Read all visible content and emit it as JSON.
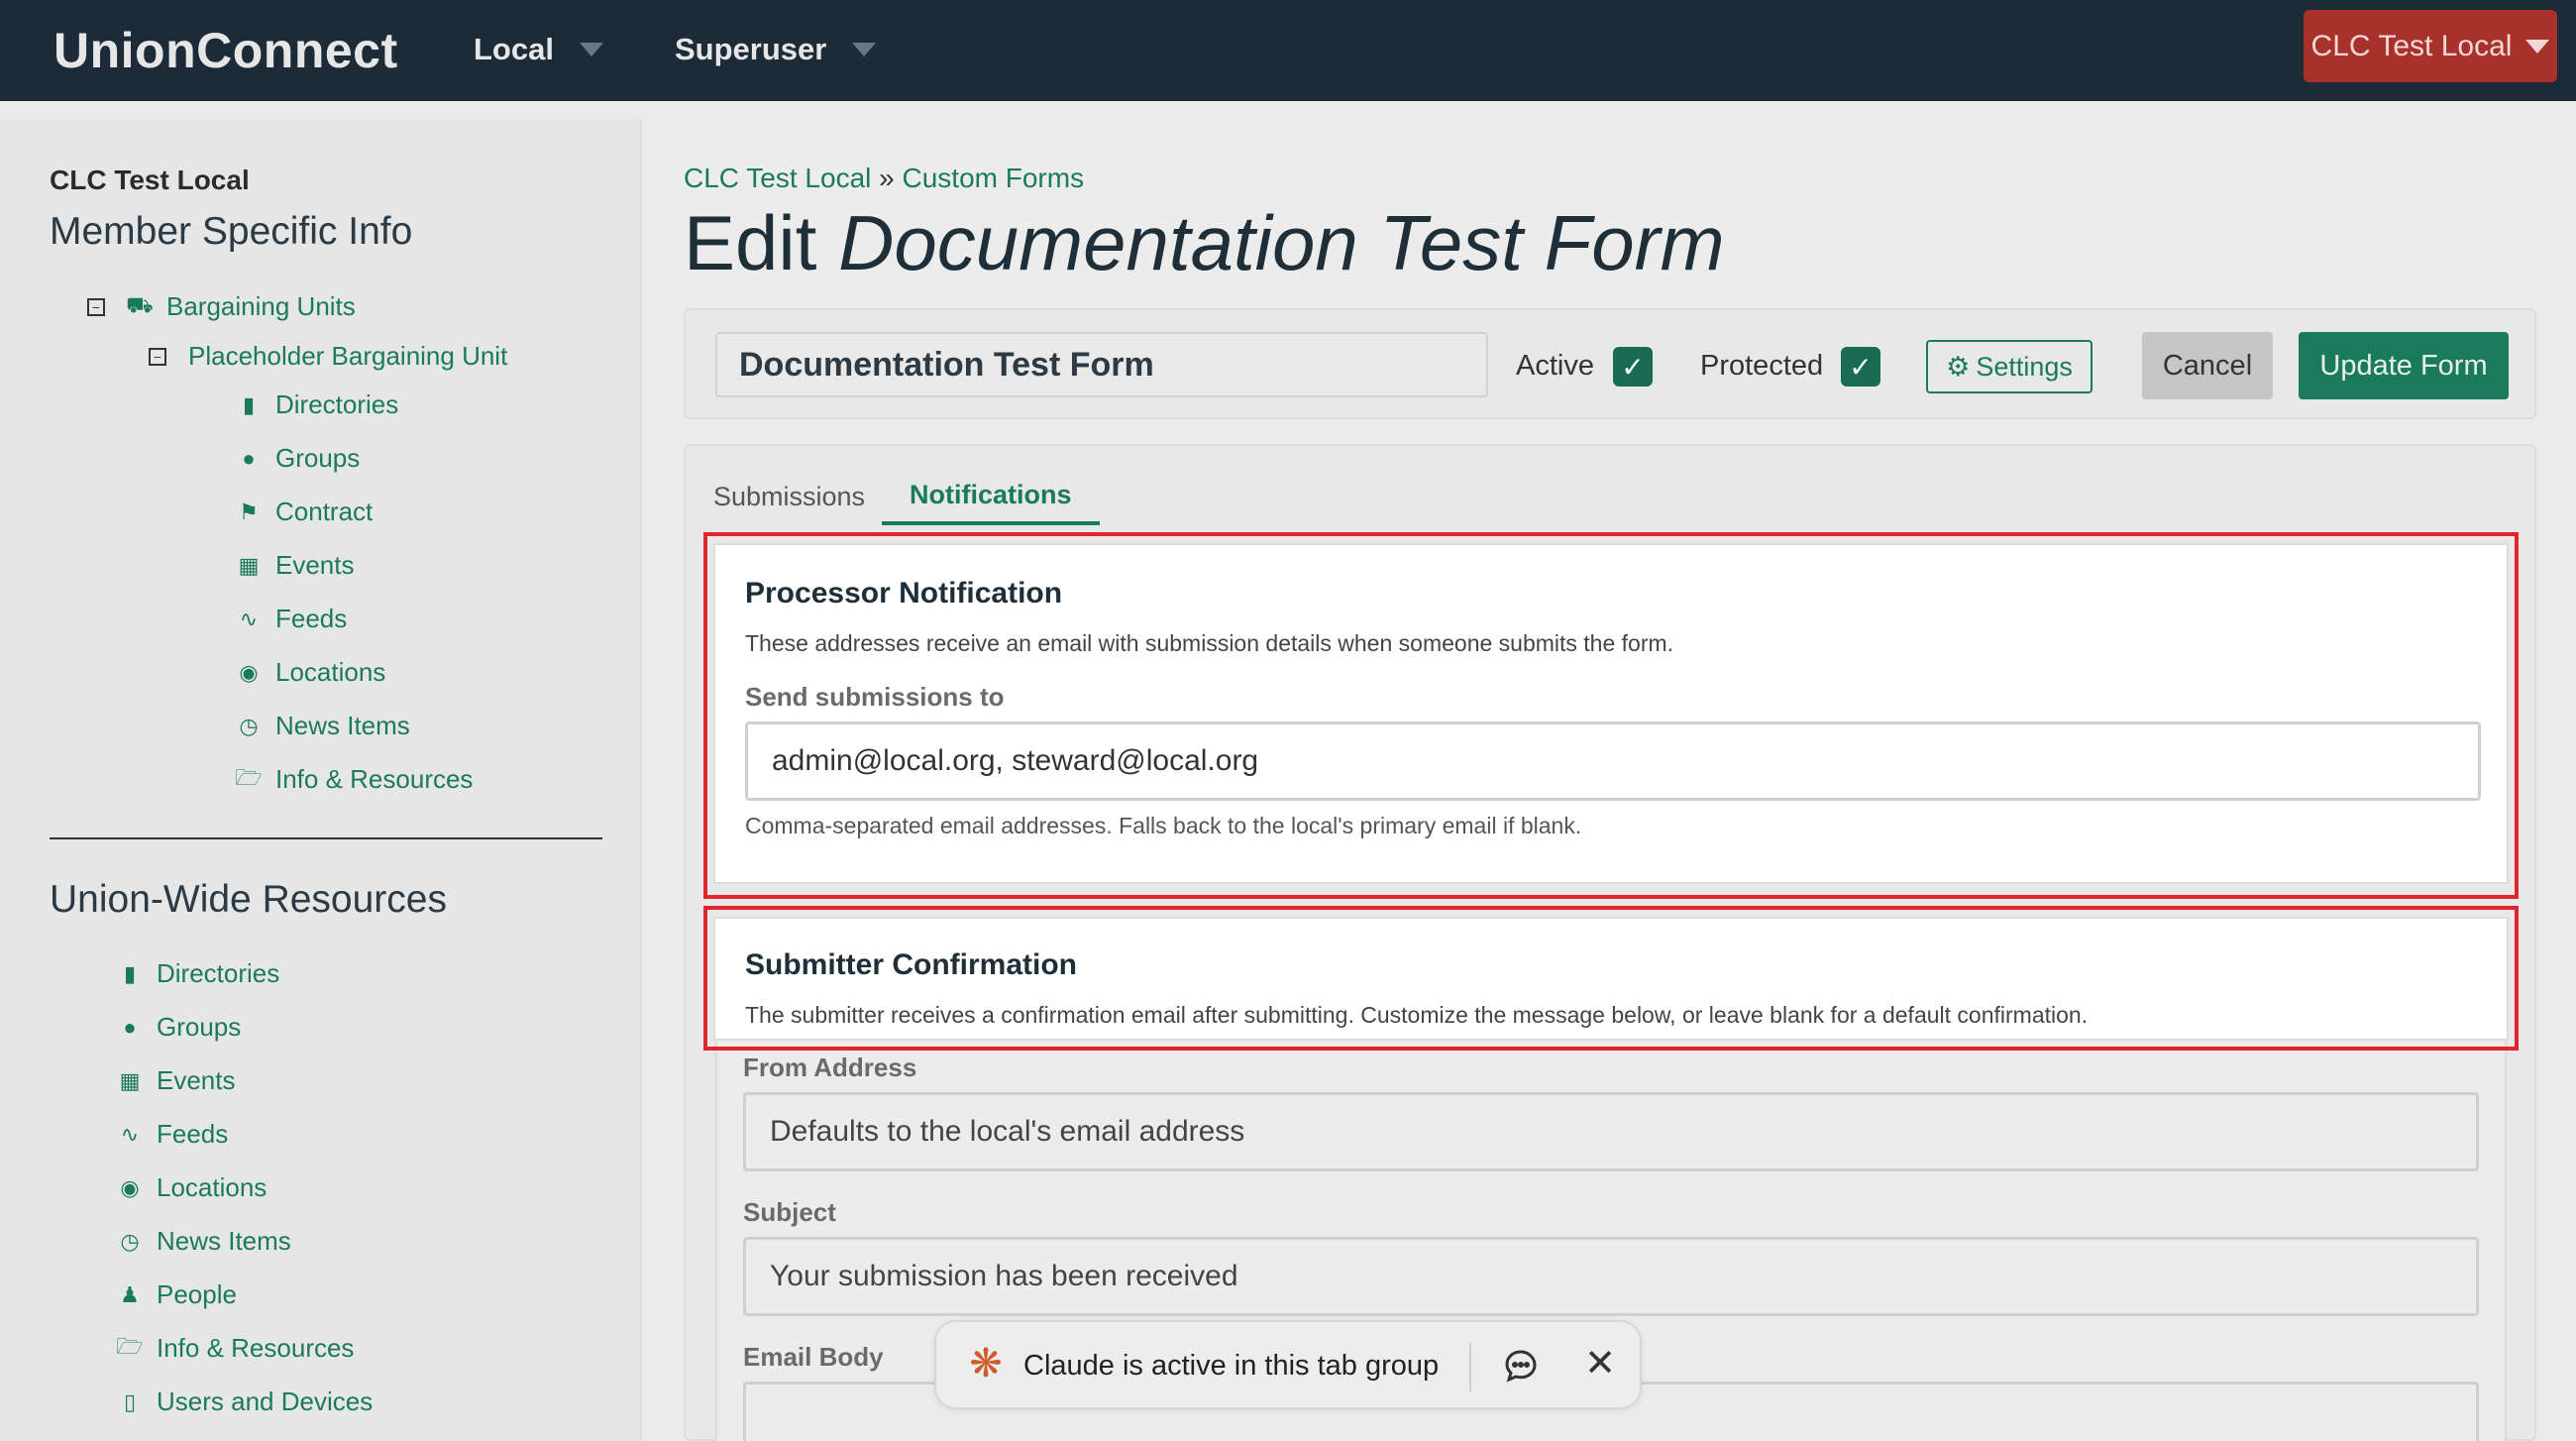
{
  "topnav": {
    "brand": "UnionConnect",
    "menus": [
      "Local",
      "Superuser"
    ],
    "local_button": "CLC Test Local"
  },
  "sidebar": {
    "local_name": "CLC Test Local",
    "member_heading": "Member Specific Info",
    "bargaining_units": "Bargaining Units",
    "placeholder_unit": "Placeholder Bargaining Unit",
    "unit_items": [
      "Directories",
      "Groups",
      "Contract",
      "Events",
      "Feeds",
      "Locations",
      "News Items",
      "Info & Resources"
    ],
    "union_heading": "Union-Wide Resources",
    "union_items": [
      "Directories",
      "Groups",
      "Events",
      "Feeds",
      "Locations",
      "News Items",
      "People",
      "Info & Resources",
      "Users and Devices"
    ]
  },
  "breadcrumb": {
    "root": "CLC Test Local",
    "sep": "»",
    "current": "Custom Forms"
  },
  "title": {
    "prefix": "Edit",
    "name": "Documentation Test Form"
  },
  "form_bar": {
    "name_value": "Documentation Test Form",
    "active_label": "Active",
    "active_checked": true,
    "protected_label": "Protected",
    "protected_checked": true,
    "settings_label": "Settings",
    "cancel_label": "Cancel",
    "update_label": "Update Form"
  },
  "tabs": {
    "submissions": "Submissions",
    "notifications": "Notifications",
    "active": "notifications"
  },
  "processor": {
    "title": "Processor Notification",
    "desc": "These addresses receive an email with submission details when someone submits the form.",
    "field_label": "Send submissions to",
    "field_value": "admin@local.org, steward@local.org",
    "hint": "Comma-separated email addresses. Falls back to the local's primary email if blank."
  },
  "submitter": {
    "title": "Submitter Confirmation",
    "desc": "The submitter receives a confirmation email after submitting. Customize the message below, or leave blank for a default confirmation.",
    "from_label": "From Address",
    "from_placeholder": "Defaults to the local's email address",
    "subject_label": "Subject",
    "subject_placeholder": "Your submission has been received",
    "body_label": "Email Body"
  },
  "toast": {
    "text": "Claude is active in this tab group"
  },
  "colors": {
    "nav_bg": "#1d2b38",
    "accent_green": "#1a7a5c",
    "local_button_red": "#a8322b",
    "highlight_red": "#e0262a"
  }
}
